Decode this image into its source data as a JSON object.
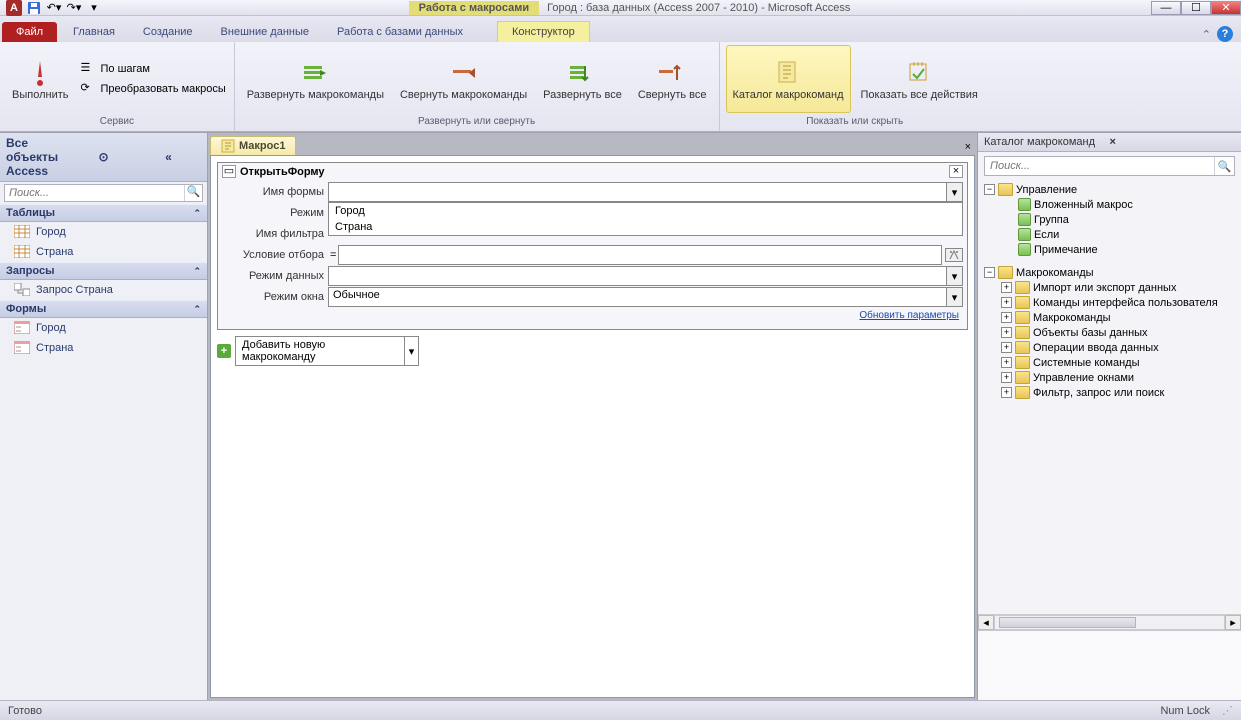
{
  "titlebar": {
    "context_label": "Работа с макросами",
    "title": "Город : база данных (Access 2007 - 2010)  -  Microsoft Access"
  },
  "ribbon_tabs": {
    "file": "Файл",
    "home": "Главная",
    "create": "Создание",
    "external": "Внешние данные",
    "dbtools": "Работа с базами данных",
    "designer": "Конструктор"
  },
  "ribbon": {
    "run": "Выполнить",
    "step": "По шагам",
    "convert": "Преобразовать макросы",
    "group_service": "Сервис",
    "expand": "Развернуть макрокоманды",
    "collapse": "Свернуть макрокоманды",
    "expand_all": "Развернуть все",
    "collapse_all": "Свернуть все",
    "group_expand": "Развернуть или свернуть",
    "catalog": "Каталог макрокоманд",
    "show_all": "Показать все действия",
    "group_show": "Показать или скрыть"
  },
  "nav": {
    "title": "Все объекты Access",
    "search_placeholder": "Поиск...",
    "sections": {
      "tables": "Таблицы",
      "queries": "Запросы",
      "forms": "Формы"
    },
    "tables": [
      "Город",
      "Страна"
    ],
    "queries": [
      "Запрос Страна"
    ],
    "forms": [
      "Город",
      "Страна"
    ]
  },
  "doc": {
    "tab": "Макрос1",
    "action_title": "ОткрытьФорму",
    "params": {
      "form_name": "Имя формы",
      "mode": "Режим",
      "filter_name": "Имя фильтра",
      "where": "Условие отбора",
      "data_mode": "Режим данных",
      "window_mode": "Режим окна"
    },
    "values": {
      "where": "=",
      "window_mode": "Обычное"
    },
    "dropdown_items": [
      "Город",
      "Страна"
    ],
    "update_link": "Обновить параметры",
    "add_action": "Добавить новую макрокоманду"
  },
  "catalog": {
    "title": "Каталог макрокоманд",
    "search_placeholder": "Поиск...",
    "flow_group": "Управление",
    "flow_items": [
      "Вложенный макрос",
      "Группа",
      "Если",
      "Примечание"
    ],
    "actions_group": "Макрокоманды",
    "action_folders": [
      "Импорт или экспорт данных",
      "Команды интерфейса пользователя",
      "Макрокоманды",
      "Объекты базы данных",
      "Операции ввода данных",
      "Системные команды",
      "Управление окнами",
      "Фильтр, запрос или поиск"
    ]
  },
  "statusbar": {
    "ready": "Готово",
    "numlock": "Num Lock"
  }
}
